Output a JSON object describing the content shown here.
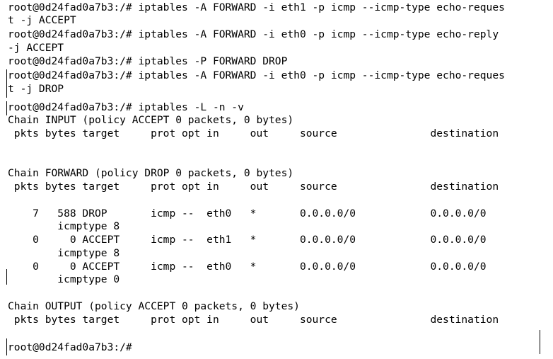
{
  "terminal": {
    "lines": [
      "root@0d24fad0a7b3:/# iptables -A FORWARD -i eth1 -p icmp --icmp-type echo-reques",
      "t -j ACCEPT",
      "root@0d24fad0a7b3:/# iptables -A FORWARD -i eth0 -p icmp --icmp-type echo-reply",
      "-j ACCEPT",
      "root@0d24fad0a7b3:/# iptables -P FORWARD DROP",
      "root@0d24fad0a7b3:/# iptables -A FORWARD -i eth0 -p icmp --icmp-type echo-reques",
      "t -j DROP",
      "root@0d24fad0a7b3:/# iptables -L -n -v",
      "Chain INPUT (policy ACCEPT 0 packets, 0 bytes)",
      " pkts bytes target     prot opt in     out     source               destination",
      "",
      "",
      "Chain FORWARD (policy DROP 0 packets, 0 bytes)",
      " pkts bytes target     prot opt in     out     source               destination",
      "",
      "    7   588 DROP       icmp --  eth0   *       0.0.0.0/0            0.0.0.0/0",
      "        icmptype 8",
      "    0     0 ACCEPT     icmp --  eth1   *       0.0.0.0/0            0.0.0.0/0",
      "        icmptype 8",
      "    0     0 ACCEPT     icmp --  eth0   *       0.0.0.0/0            0.0.0.0/0",
      "        icmptype 0",
      "",
      "Chain OUTPUT (policy ACCEPT 0 packets, 0 bytes)",
      " pkts bytes target     prot opt in     out     source               destination",
      "",
      "root@0d24fad0a7b3:/# "
    ]
  }
}
